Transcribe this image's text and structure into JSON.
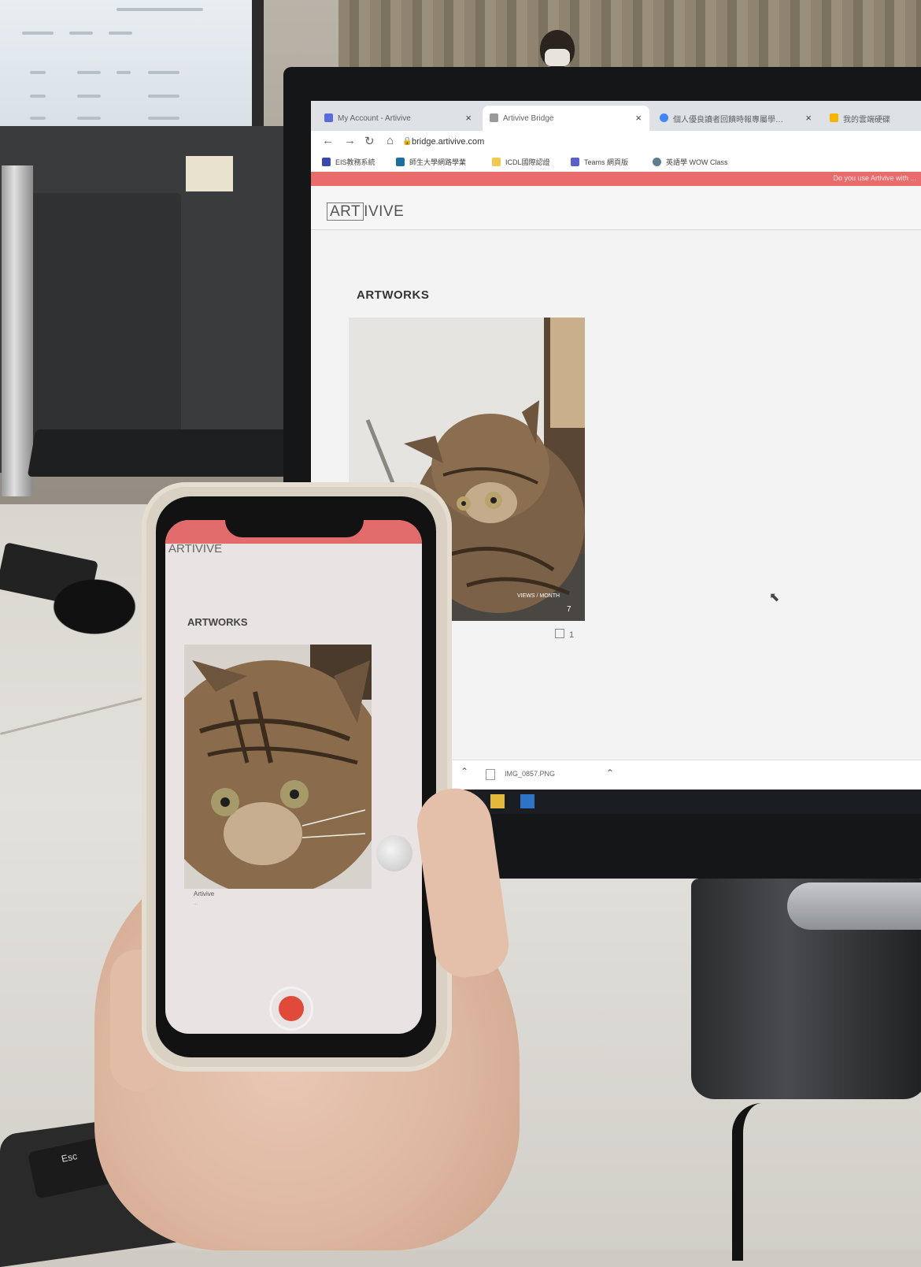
{
  "browser": {
    "tabs": [
      {
        "title": "My Account - Artivive",
        "favicon_color": "#5b6bd8"
      },
      {
        "title": "Artivive Bridge",
        "favicon_color": "#777777",
        "active": true
      },
      {
        "title": "個人優良讀者回饋時報專屬學…",
        "favicon_color": "#4285f4"
      },
      {
        "title": "我的雲端硬碟",
        "favicon_color": "#f4b400"
      }
    ],
    "close_glyph": "×",
    "url": "bridge.artivive.com",
    "bookmarks": [
      {
        "label": "EIS教務系統",
        "color": "#3949ab"
      },
      {
        "label": "師生大學網路學業",
        "color": "#1e6f9f"
      },
      {
        "label": "ICDL國際認證",
        "color": "#f2c94c"
      },
      {
        "label": "Teams 網頁版",
        "color": "#5b5fc7"
      },
      {
        "label": "英語學 WOW Class",
        "color": "#607d8b"
      }
    ],
    "banner": "Do you use Artivive with ..."
  },
  "site": {
    "logo_boxed": "ART",
    "logo_rest": "IVIVE",
    "section_title": "ARTWORKS",
    "card_views": "VIEWS / MONTH",
    "card_count": "7",
    "card_meta": "1",
    "download_file": "IMG_0857.PNG"
  },
  "phone": {
    "logo": "ARTIVIVE",
    "section_title": "ARTWORKS",
    "card_title": "Artivive",
    "card_sub": "..."
  },
  "keyboard": {
    "esc_label": "Esc"
  },
  "colors": {
    "banner": "#e96b6b",
    "record": "#e04a3a",
    "cat_fur": "#8b6a48"
  }
}
